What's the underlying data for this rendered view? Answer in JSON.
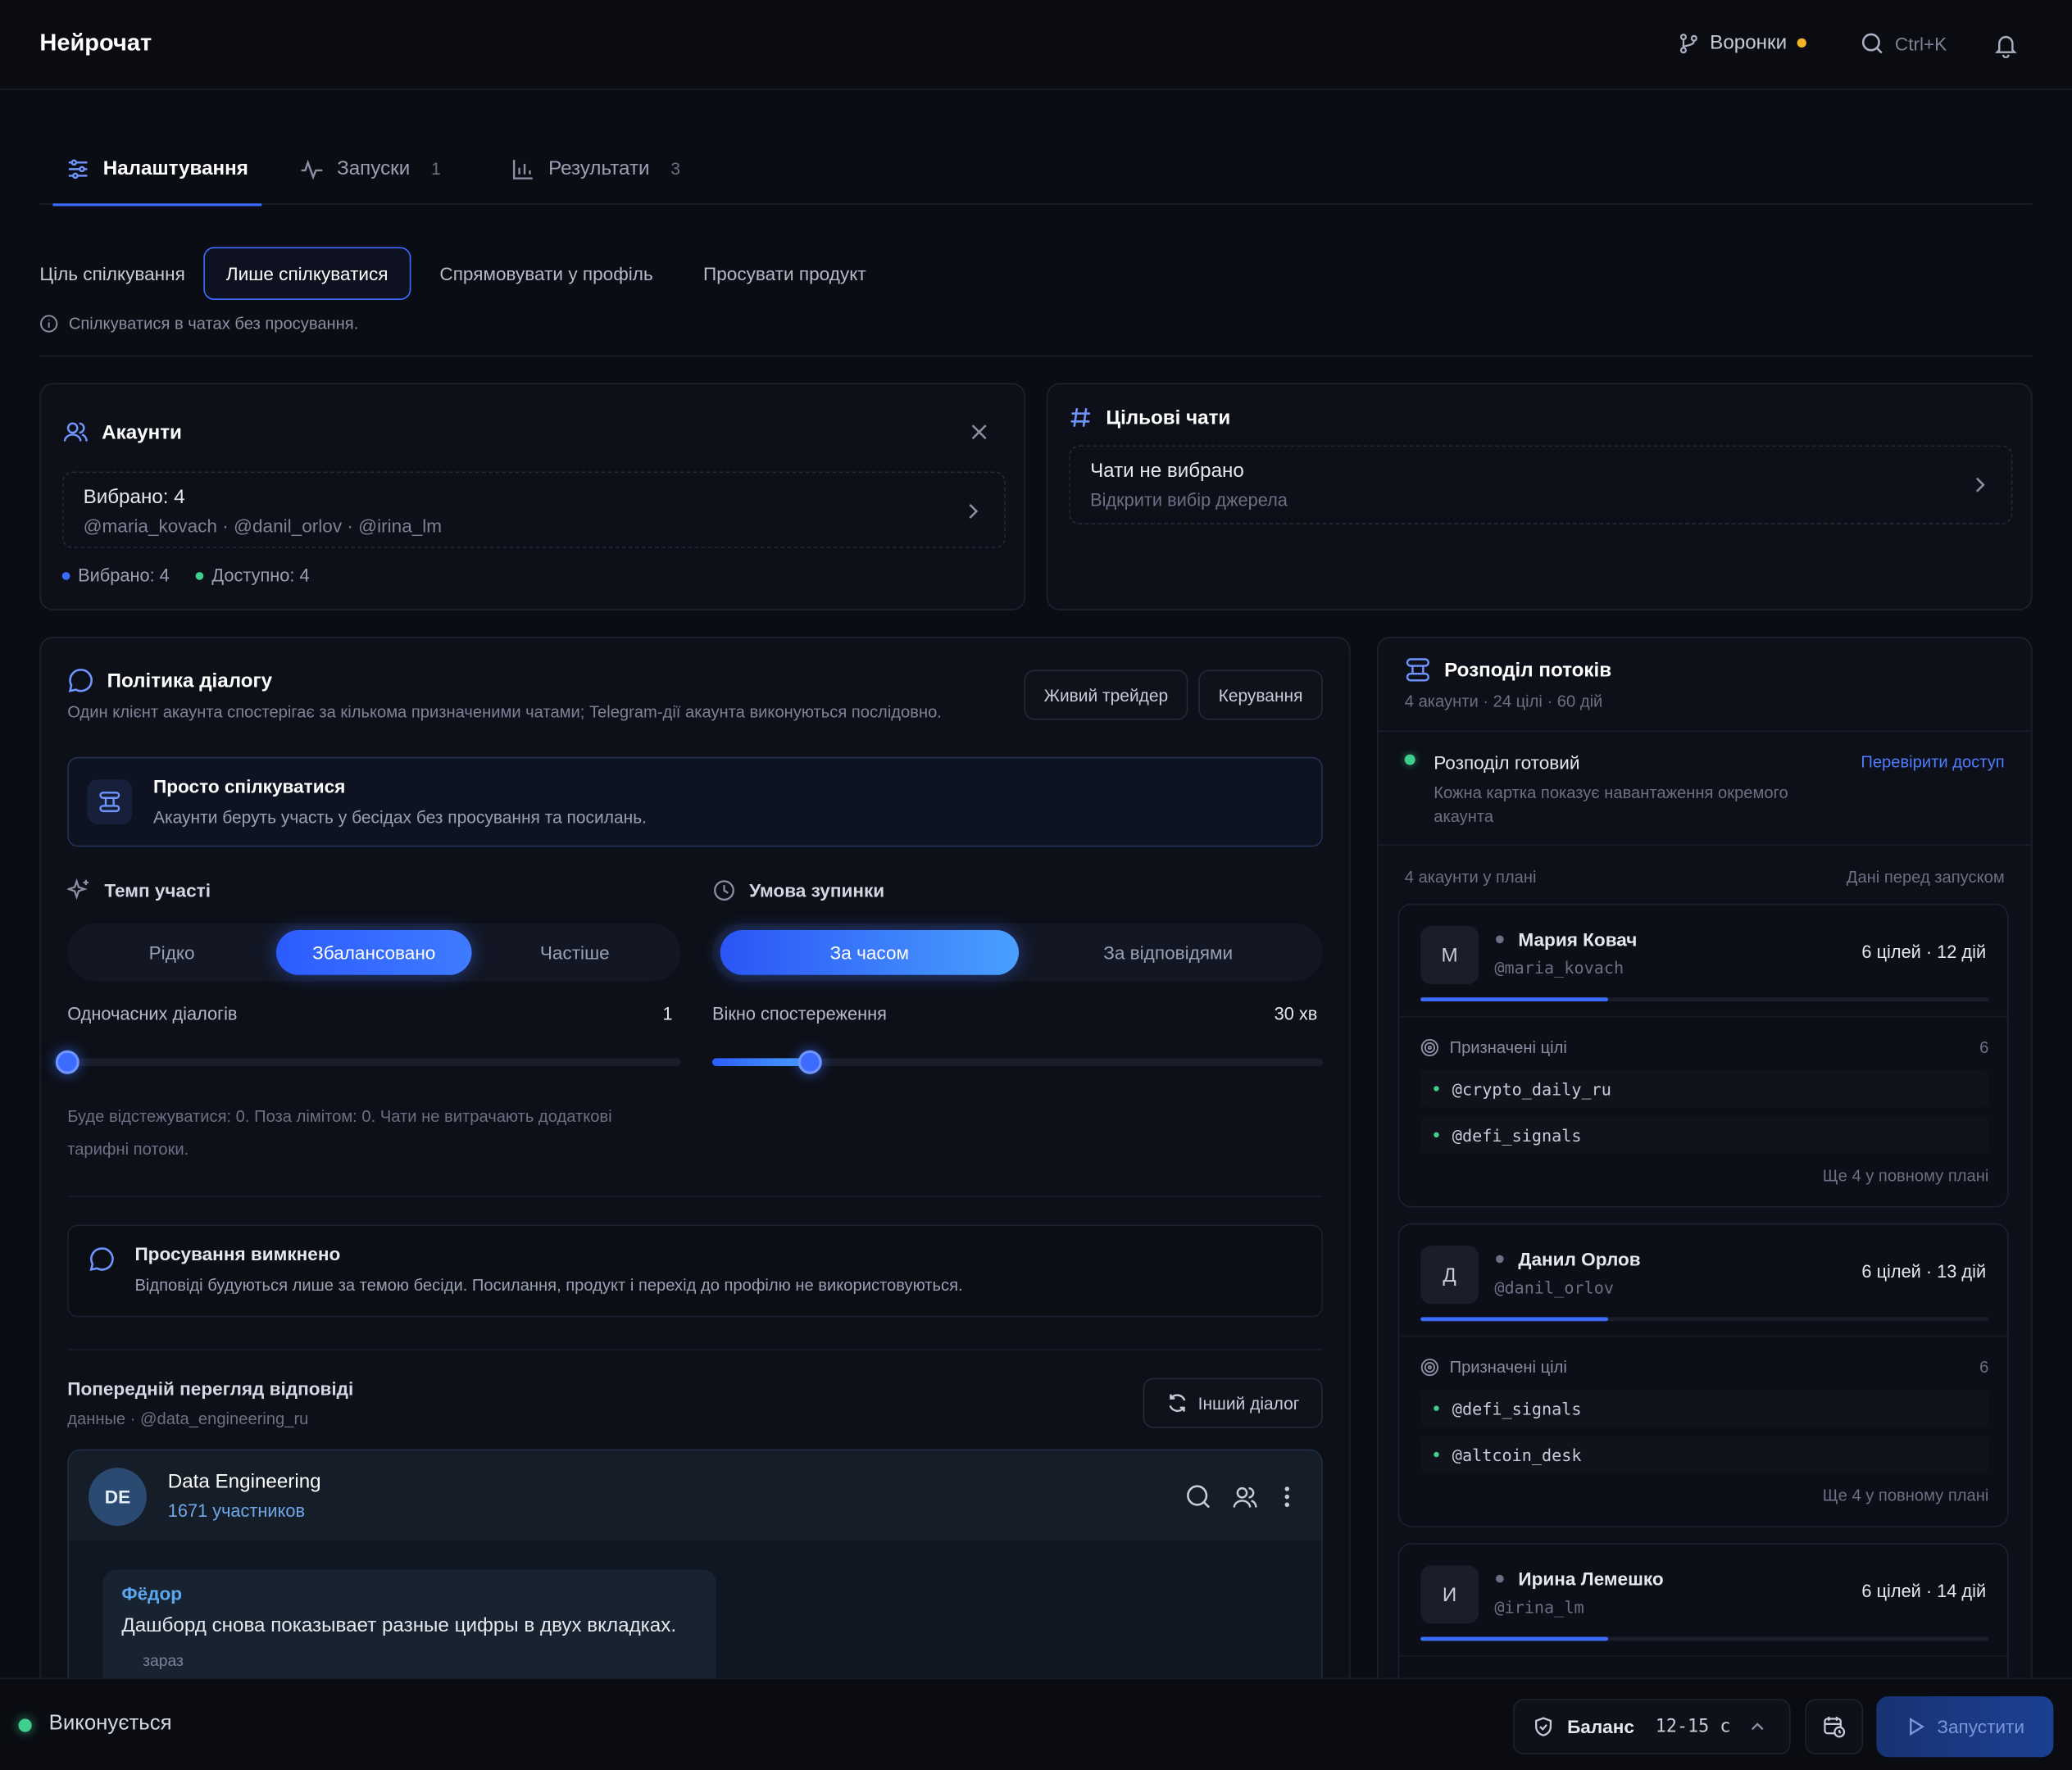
{
  "app": {
    "title": "Нейрочат"
  },
  "topbar": {
    "funnels_label": "Воронки",
    "search_shortcut": "Ctrl+K"
  },
  "tabs": [
    {
      "label": "Налаштування",
      "count": ""
    },
    {
      "label": "Запуски",
      "count": "1"
    },
    {
      "label": "Результати",
      "count": "3"
    }
  ],
  "goal": {
    "label": "Ціль спілкування",
    "options": [
      "Лише спілкуватися",
      "Спрямовувати у профіль",
      "Просувати продукт"
    ],
    "selected": "Лише спілкуватися",
    "hint": "Спілкуватися в чатах без просування."
  },
  "accounts": {
    "title": "Акаунти",
    "selected_text": "Вибрано: 4",
    "handles": "@maria_kovach · @danil_orlov · @irina_lm",
    "legend_selected": "Вибрано: 4",
    "legend_available": "Доступно: 4"
  },
  "target_chats": {
    "title": "Цільові чати",
    "empty_title": "Чати не вибрано",
    "empty_sub": "Відкрити вибір джерела"
  },
  "policy": {
    "title": "Політика діалогу",
    "subtitle": "Один клієнт акаунта спостерігає за кількома призначеними чатами; Telegram-дії акаунта виконуються послідовно.",
    "btn_live": "Живий трейдер",
    "btn_manage": "Керування",
    "mode_title": "Просто спілкуватися",
    "mode_sub": "Акаунти беруть участь у бесідах без просування та посилань.",
    "pace_label": "Темп участі",
    "pace_options": [
      "Рідко",
      "Збалансовано",
      "Частіше"
    ],
    "pace_selected": "Збалансовано",
    "stop_label": "Умова зупинки",
    "stop_options": [
      "За часом",
      "За відповідями"
    ],
    "stop_selected": "За часом",
    "concurrent_label": "Одночасних діалогів",
    "concurrent_value": "1",
    "concurrent_fraction": 0,
    "window_label": "Вікно спостереження",
    "window_value": "30 хв",
    "window_fraction": 0.16,
    "tracking_note": "Буде відстежуватися: 0. Поза лімітом: 0. Чати не витрачають додаткові тарифні потоки.",
    "promo_title": "Просування вимкнено",
    "promo_sub": "Відповіді будуються лише за темою бесіди. Посилання, продукт і перехід до профілю не використовуються."
  },
  "preview": {
    "title": "Попередній перегляд відповіді",
    "meta": "данные · @data_engineering_ru",
    "other_btn": "Інший діалог",
    "chat_avatar": "DE",
    "chat_name": "Data Engineering",
    "chat_members": "1671 участников",
    "msg_author": "Фёдор",
    "msg_text": "Дашборд снова показывает разные цифры в двух вкладках.",
    "msg_time": "зараз"
  },
  "distribution": {
    "title": "Розподіл потоків",
    "meta": "4 акаунти · 24 цілі · 60 дій",
    "ready_title": "Розподіл готовий",
    "ready_sub": "Кожна картка показує навантаження окремого акаунта",
    "check_link": "Перевірити доступ",
    "plan_label": "4 акаунти у плані",
    "plan_right": "Дані перед запуском",
    "accounts": [
      {
        "initial": "М",
        "name": "Мария Ковач",
        "handle": "@maria_kovach",
        "stats": "6 цілей · 12 дій",
        "load": 0.33,
        "targets_label": "Призначені цілі",
        "targets_count": "6",
        "targets": [
          "@crypto_daily_ru",
          "@defi_signals"
        ],
        "more": "Ще 4 у повному плані"
      },
      {
        "initial": "Д",
        "name": "Данил Орлов",
        "handle": "@danil_orlov",
        "stats": "6 цілей · 13 дій",
        "load": 0.33,
        "targets_label": "Призначені цілі",
        "targets_count": "6",
        "targets": [
          "@defi_signals",
          "@altcoin_desk"
        ],
        "more": "Ще 4 у повному плані"
      },
      {
        "initial": "И",
        "name": "Ирина Лемешко",
        "handle": "@irina_lm",
        "stats": "6 цілей · 14 дій",
        "load": 0.33
      }
    ]
  },
  "bottombar": {
    "status": "Виконується",
    "balance_label": "Баланс",
    "balance_value": "12-15 с",
    "run_label": "Запустити"
  },
  "colors": {
    "accent": "#3b6cff",
    "success": "#3fcf8e",
    "amber": "#f5b428"
  }
}
